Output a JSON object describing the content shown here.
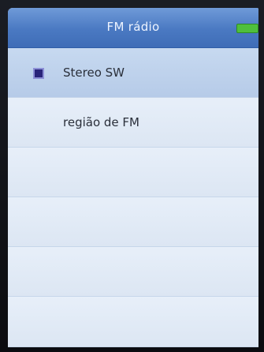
{
  "header": {
    "title": "FM rádio"
  },
  "menu": {
    "items": [
      {
        "label": "Stereo SW"
      },
      {
        "label": "região de FM"
      },
      {
        "label": ""
      },
      {
        "label": ""
      },
      {
        "label": ""
      },
      {
        "label": ""
      }
    ]
  },
  "colors": {
    "header": "#4a79c2",
    "selected_row": "#c7d9f0",
    "row": "#e7eff9",
    "battery": "#4fbf3c",
    "selected_icon": "#29247a"
  },
  "icons": {
    "battery": "battery-icon",
    "selected": "selected-square-icon"
  }
}
